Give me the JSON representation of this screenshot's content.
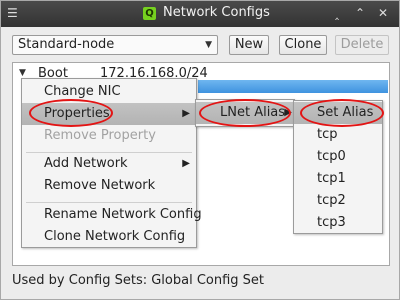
{
  "window": {
    "title": "Network Configs",
    "app_icon_letter": "Q",
    "menu_icon": "☰",
    "min_icon": "‸",
    "max_icon": "⌃",
    "close_icon": "✕"
  },
  "toolbar": {
    "config_select_value": "Standard-node",
    "new_label": "New",
    "clone_label": "Clone",
    "delete_label": "Delete"
  },
  "tree": {
    "node_label": "Boot",
    "node_value": "172.16.168.0/24"
  },
  "context_menu": {
    "items": [
      "Change NIC",
      "Properties",
      "Remove Property",
      "Add Network",
      "Remove Network",
      "Rename Network Config",
      "Clone Network Config"
    ]
  },
  "submenu_properties": {
    "items": [
      "LNet Alias"
    ]
  },
  "submenu_lnet_alias": {
    "items": [
      "Set Alias",
      "tcp",
      "tcp0",
      "tcp1",
      "tcp2",
      "tcp3"
    ]
  },
  "status": {
    "text": "Used by Config Sets: Global Config Set"
  },
  "colors": {
    "selection": "#4a9de4",
    "annotation": "#e31414",
    "app_icon": "#76d11f"
  }
}
